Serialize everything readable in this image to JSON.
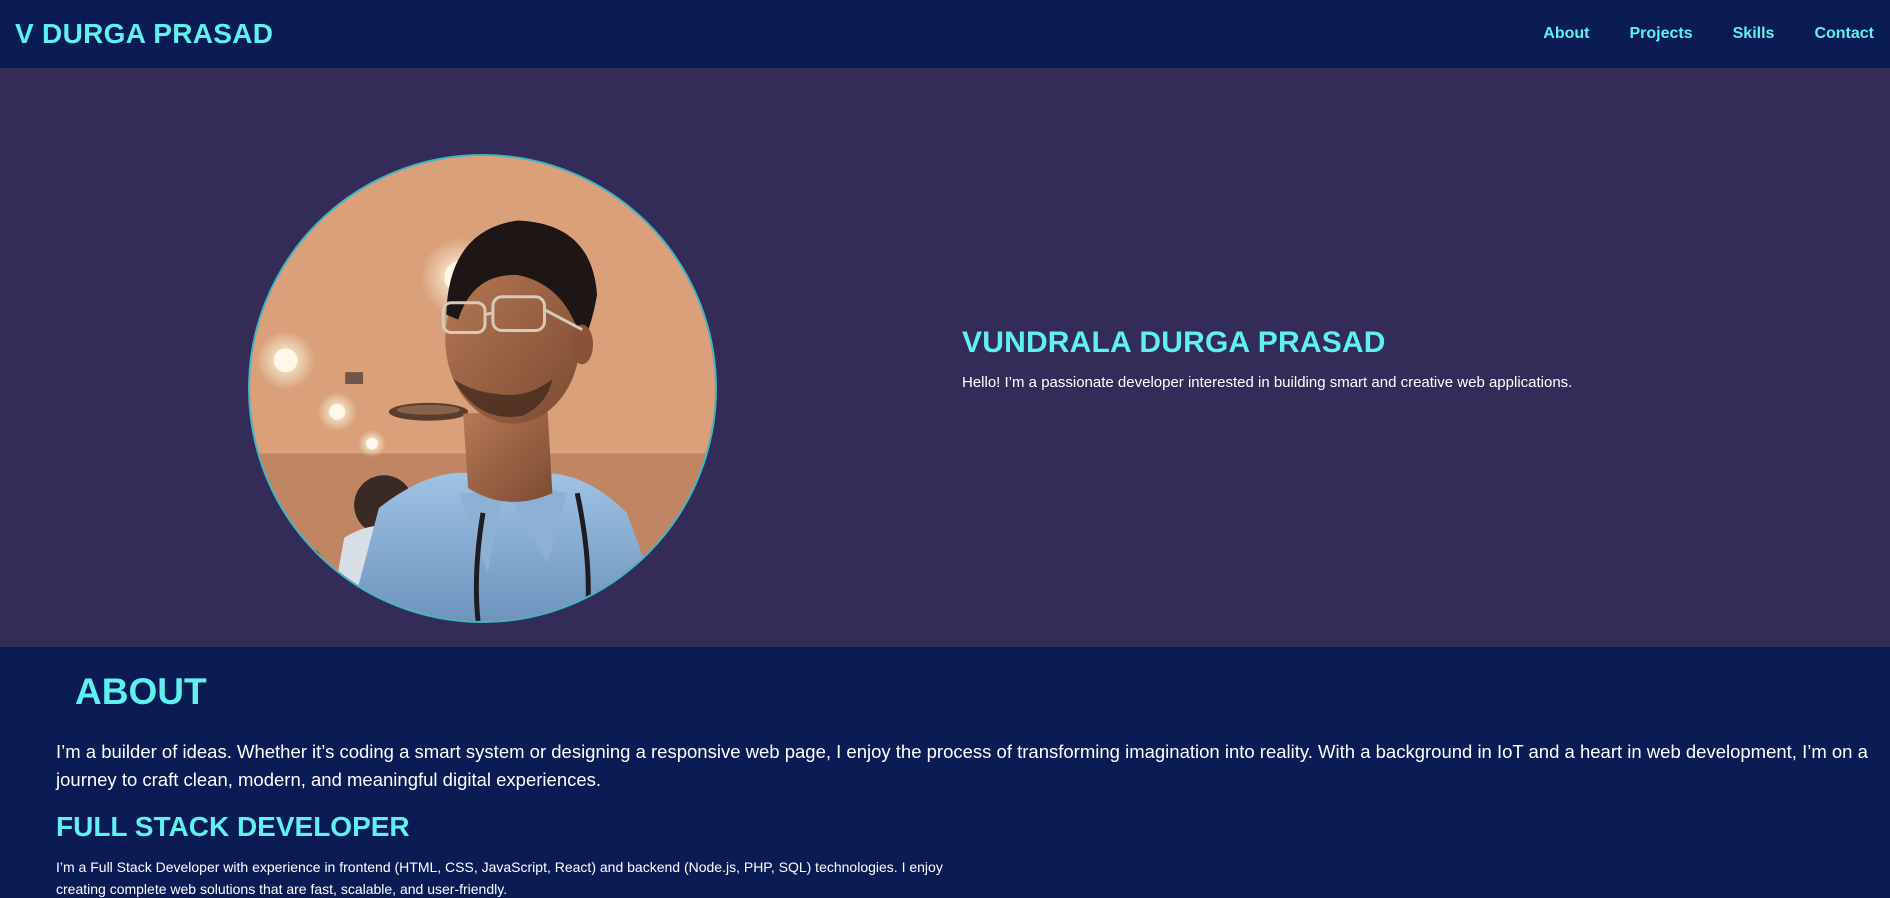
{
  "header": {
    "brand": "V DURGA PRASAD",
    "nav": [
      "About",
      "Projects",
      "Skills",
      "Contact"
    ]
  },
  "hero": {
    "name": "VUNDRALA DURGA PRASAD",
    "tagline": "Hello! I’m a passionate developer interested in building smart and creative web applications."
  },
  "about": {
    "title": "ABOUT",
    "body": "I’m a builder of ideas. Whether it’s coding a smart system or designing a responsive web page, I enjoy the process of transforming imagination into reality. With a background in IoT and a heart in web development, I’m on a journey to craft clean, modern, and meaningful digital experiences.",
    "role_title": "FULL STACK DEVELOPER",
    "role_body": "I’m a Full Stack Developer with experience in frontend (HTML, CSS, JavaScript, React) and backend (Node.js, PHP, SQL) technologies. I enjoy creating complete web solutions that are fast, scalable, and user-friendly."
  },
  "colors": {
    "navy": "#0b1c54",
    "hero_bg": "#342c58",
    "accent": "#5ef1ee"
  }
}
